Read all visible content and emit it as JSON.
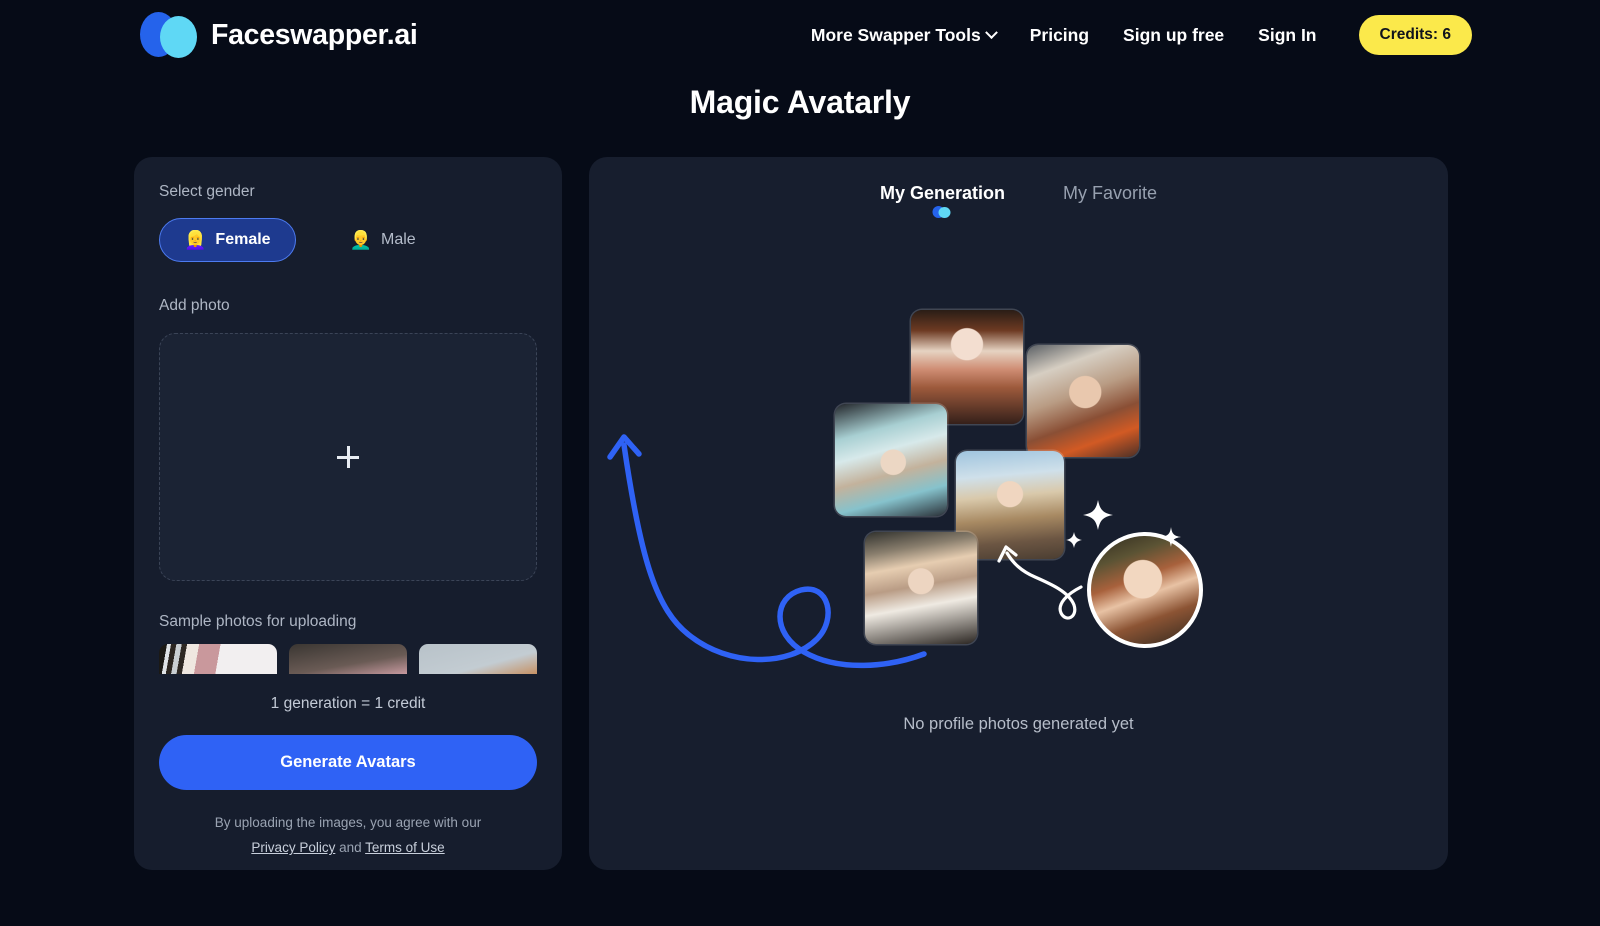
{
  "brand": {
    "name": "Faceswapper.ai",
    "logo_icon": "two-circles-logo-icon",
    "color_blue": "#2563eb",
    "color_cyan": "#5fd8f5"
  },
  "nav": {
    "items": [
      {
        "label": "More Swapper Tools",
        "has_chevron": true,
        "icon": "chevron-down-icon"
      },
      {
        "label": "Pricing",
        "has_chevron": false
      },
      {
        "label": "Sign up free",
        "has_chevron": false
      },
      {
        "label": "Sign In",
        "has_chevron": false
      }
    ],
    "credits_badge": {
      "label": "Credits: 6",
      "color": "#fbe94b"
    }
  },
  "page": {
    "title": "Magic Avatarly",
    "background": "#060b17",
    "panel_bg": "#171e2e"
  },
  "left_panel": {
    "gender": {
      "label": "Select gender",
      "options": [
        {
          "label": "Female",
          "emoji": "👱‍♀️",
          "selected": true
        },
        {
          "label": "Male",
          "emoji": "👱‍♂️",
          "selected": false
        }
      ]
    },
    "add_photo": {
      "label": "Add photo",
      "icon": "plus-icon"
    },
    "samples": {
      "label": "Sample photos for uploading",
      "items": [
        {
          "name": "sample-photo-1"
        },
        {
          "name": "sample-photo-2"
        },
        {
          "name": "sample-photo-3"
        }
      ]
    },
    "credit_note": "1 generation = 1 credit",
    "generate_button": {
      "label": "Generate Avatars",
      "color": "#2f62f5"
    },
    "legal": {
      "line1": "By uploading the images, you agree with our",
      "privacy": "Privacy Policy",
      "and": " and ",
      "terms": "Terms of Use"
    }
  },
  "right_panel": {
    "tabs": [
      {
        "label": "My Generation",
        "active": true
      },
      {
        "label": "My Favorite",
        "active": false
      }
    ],
    "empty_state": "No profile photos generated yet",
    "illustration": {
      "cards": [
        {
          "name": "avatar-card-queen"
        },
        {
          "name": "avatar-card-astronaut"
        },
        {
          "name": "avatar-card-vintage-hat"
        },
        {
          "name": "avatar-card-warrior"
        },
        {
          "name": "avatar-card-victorian"
        }
      ],
      "source_photo": {
        "name": "source-photo-circle"
      },
      "arrows": [
        {
          "name": "blue-curved-arrow",
          "color": "#2f62f5"
        },
        {
          "name": "white-curved-arrow",
          "color": "#ffffff"
        }
      ],
      "sparkles": 3
    }
  }
}
